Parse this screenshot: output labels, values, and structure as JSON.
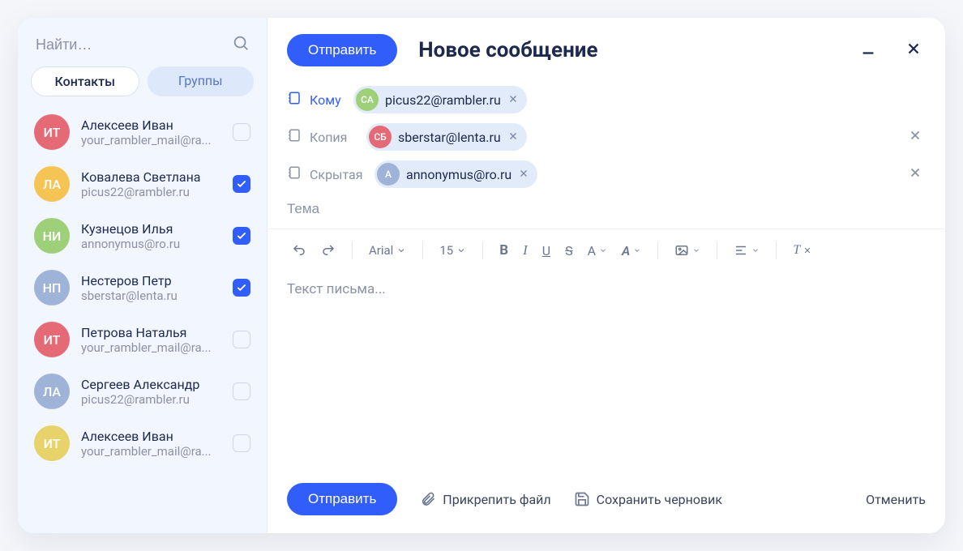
{
  "sidebar": {
    "search_placeholder": "Найти…",
    "tabs": {
      "contacts": "Контакты",
      "groups": "Группы"
    },
    "contacts": [
      {
        "initials": "ИТ",
        "color": "#e46a76",
        "name": "Алексеев Иван",
        "email": "your_rambler_mail@ra...",
        "checked": false
      },
      {
        "initials": "ЛА",
        "color": "#f6c454",
        "name": "Ковалева Светлана",
        "email": "picus22@rambler.ru",
        "checked": true
      },
      {
        "initials": "НИ",
        "color": "#9ed07a",
        "name": "Кузнецов Илья",
        "email": "annonymus@ro.ru",
        "checked": true
      },
      {
        "initials": "НП",
        "color": "#9fb3d9",
        "name": "Нестеров Петр",
        "email": "sberstar@lenta.ru",
        "checked": true
      },
      {
        "initials": "ИТ",
        "color": "#e46a76",
        "name": "Петрова Наталья",
        "email": "your_rambler_mail@ra...",
        "checked": false
      },
      {
        "initials": "ЛА",
        "color": "#9fb3d9",
        "name": "Сергеев Александр",
        "email": "picus22@rambler.ru",
        "checked": false
      },
      {
        "initials": "ИТ",
        "color": "#e7d36a",
        "name": "Алексеев Иван",
        "email": "your_rambler_mail@ra...",
        "checked": false
      }
    ]
  },
  "compose": {
    "send": "Отправить",
    "title": "Новое сообщение",
    "labels": {
      "to": "Кому",
      "cc": "Копия",
      "bcc": "Скрытая"
    },
    "to": {
      "initials": "СА",
      "color": "#9ed07a",
      "email": "picus22@rambler.ru"
    },
    "cc": {
      "initials": "СБ",
      "color": "#e46a76",
      "email": "sberstar@lenta.ru"
    },
    "bcc": {
      "initials": "А",
      "color": "#9fb3d9",
      "email": "annonymus@ro.ru"
    },
    "subject_placeholder": "Тема",
    "body_placeholder": "Текст письма...",
    "toolbar": {
      "font": "Arial",
      "size": "15"
    },
    "footer": {
      "send": "Отправить",
      "attach": "Прикрепить файл",
      "save_draft": "Сохранить черновик",
      "cancel": "Отменить"
    }
  }
}
